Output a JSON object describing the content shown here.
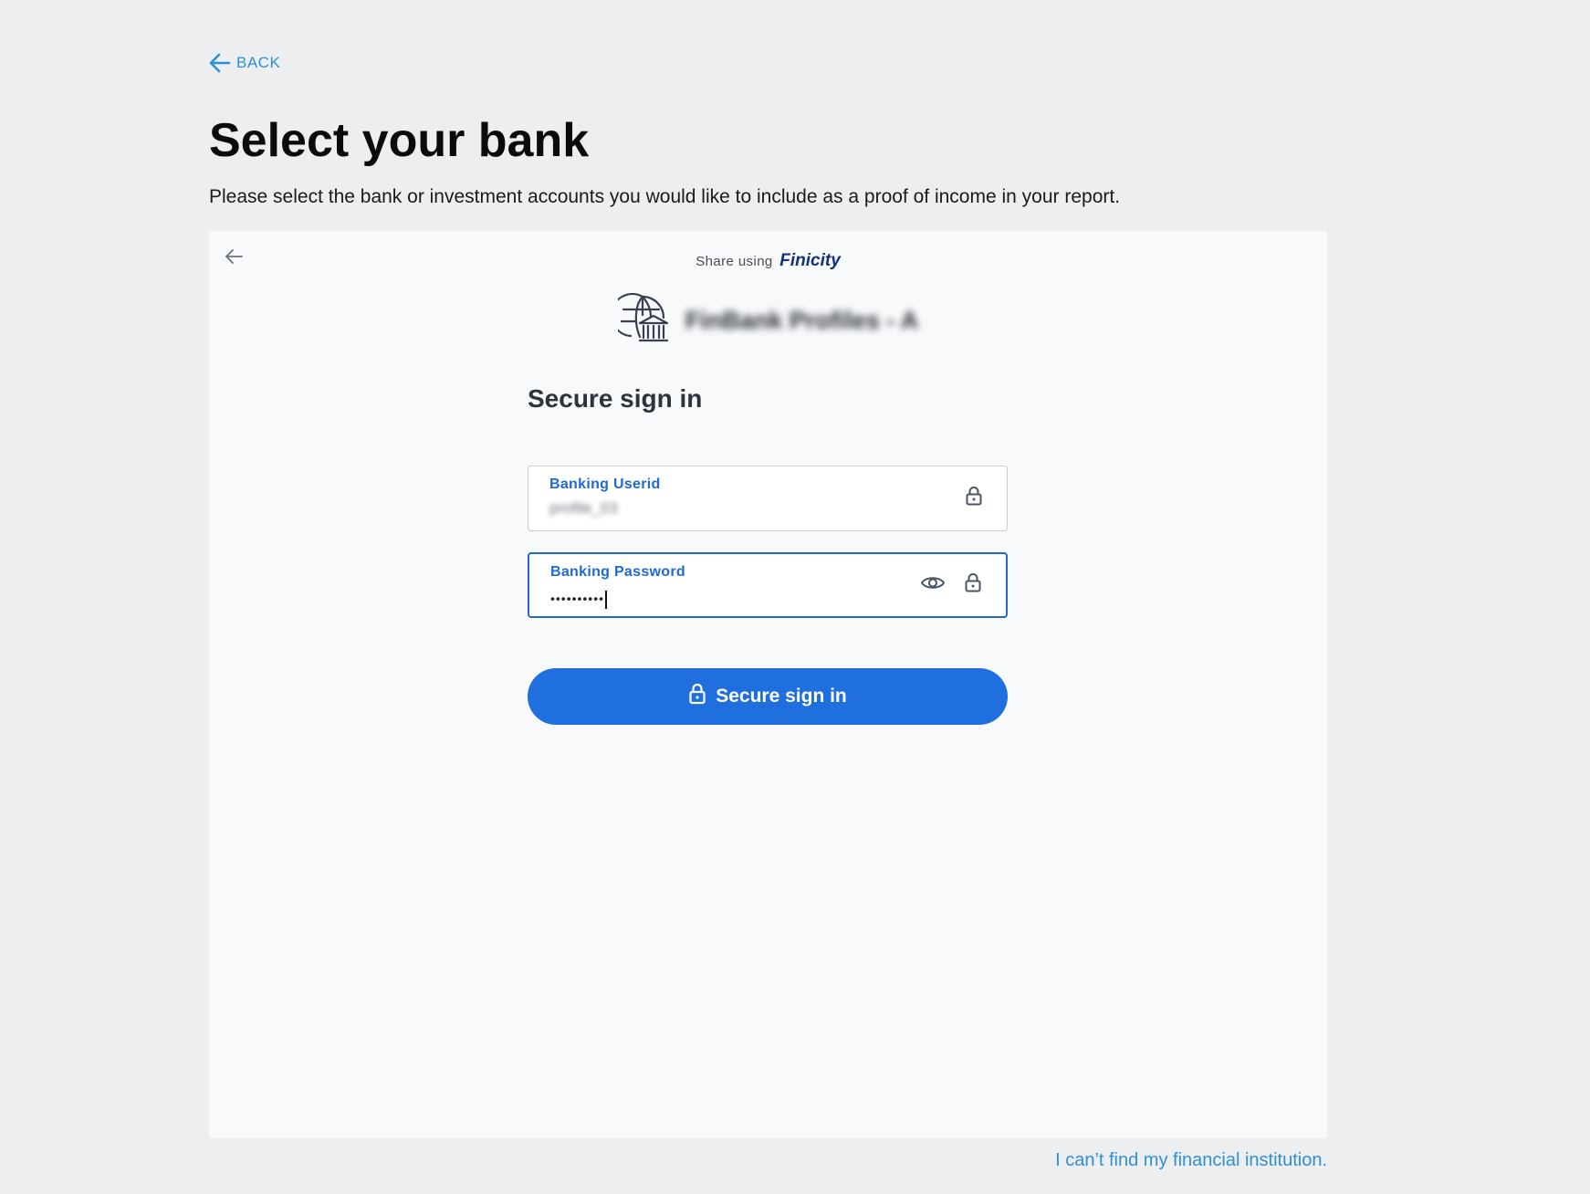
{
  "nav": {
    "back_label": "BACK"
  },
  "header": {
    "title": "Select your bank",
    "description": "Please select the bank or investment accounts you would like to include as a proof of income in your report."
  },
  "widget": {
    "share_prefix": "Share using",
    "share_brand": "Finicity",
    "institution_name": "FinBank Profiles - A",
    "institution_icon": "globe-bank-icon",
    "form_title": "Secure sign in",
    "userid": {
      "label": "Banking Userid",
      "value": "profile_03",
      "icon": "lock-icon"
    },
    "password": {
      "label": "Banking Password",
      "masked_value": "••••••••••",
      "show_icon": "eye-icon",
      "icon": "lock-icon"
    },
    "submit_label": "Secure sign in"
  },
  "footer": {
    "cant_find_link": "I can’t find my financial institution."
  },
  "colors": {
    "background": "#edeef0",
    "panel": "#f7f9fb",
    "primary": "#1f6fde",
    "link": "#2f8fd6",
    "field_label": "#1f68d8"
  }
}
